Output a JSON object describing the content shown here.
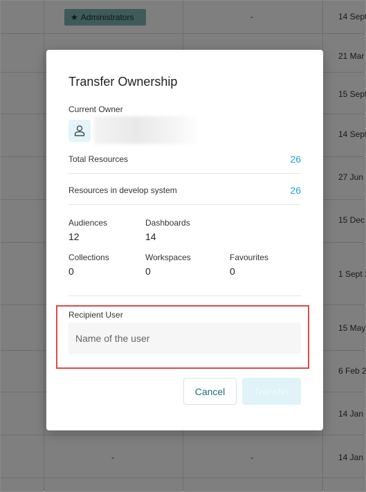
{
  "background": {
    "role_badge": "Administrators",
    "dash": "-",
    "dates": [
      "14 Sept",
      "21 Mar",
      "15 Sept",
      "14 Sept",
      "27 Jun",
      "15 Dec",
      "1 Sept 2",
      "15 May",
      "6 Feb 2",
      "14 Jan",
      "14 Jan"
    ]
  },
  "modal": {
    "title": "Transfer Ownership",
    "current_owner_label": "Current Owner",
    "stats": [
      {
        "label": "Total Resources",
        "value": "26"
      },
      {
        "label": "Resources in develop system",
        "value": "26"
      }
    ],
    "breakdown": [
      {
        "label": "Audiences",
        "value": "12"
      },
      {
        "label": "Dashboards",
        "value": "14"
      },
      {
        "label": "Collections",
        "value": "0"
      },
      {
        "label": "Workspaces",
        "value": "0"
      },
      {
        "label": "Favourites",
        "value": "0"
      }
    ],
    "recipient": {
      "label": "Recipient User",
      "placeholder": "Name of the user",
      "value": ""
    },
    "buttons": {
      "cancel": "Cancel",
      "transfer": "Transfer"
    }
  },
  "colors": {
    "accent": "#1ba7d6",
    "highlight": "#e04848",
    "badge": "#7fb5b7"
  }
}
